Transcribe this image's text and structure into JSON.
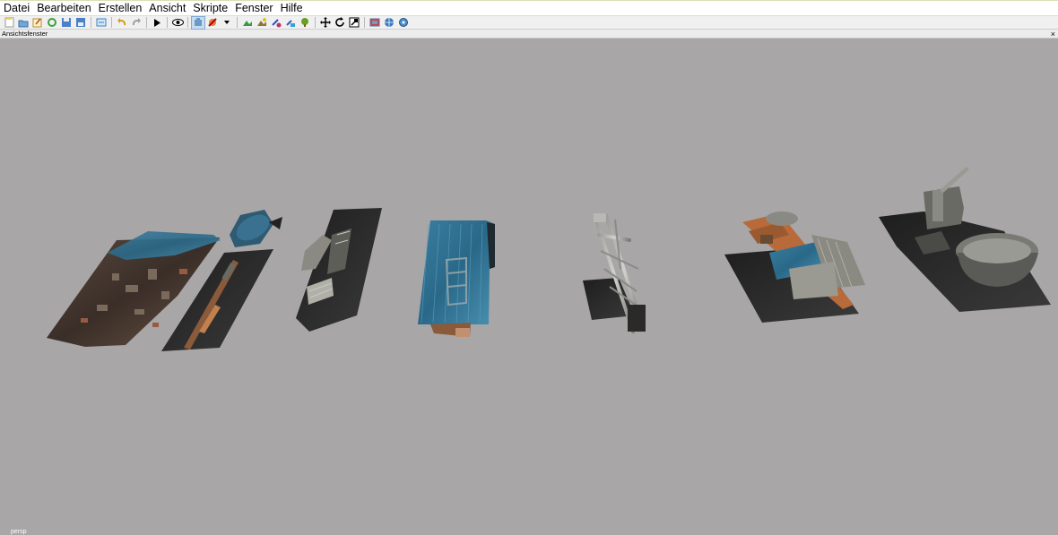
{
  "menubar": {
    "items": [
      "Datei",
      "Bearbeiten",
      "Erstellen",
      "Ansicht",
      "Skripte",
      "Fenster",
      "Hilfe"
    ]
  },
  "toolbar": {
    "icons": [
      "new-file-icon",
      "open-file-icon",
      "edit-icon",
      "refresh-icon",
      "save-icon",
      "save-as-icon",
      "import-icon",
      "undo-icon",
      "redo-icon",
      "play-icon",
      "eye-icon",
      "camera-icon",
      "no-render-icon",
      "dropdown-arrow-icon",
      "terrain-icon",
      "paint-icon",
      "object-icon",
      "vegetation-icon",
      "tree-icon",
      "move-icon",
      "rotate-icon",
      "scale-icon",
      "window-icon",
      "globe-icon",
      "settings-icon"
    ]
  },
  "panel": {
    "title": "Ansichtsfenster",
    "close": "×"
  },
  "viewport": {
    "camera": "persp",
    "background": "#a8a6a7"
  }
}
